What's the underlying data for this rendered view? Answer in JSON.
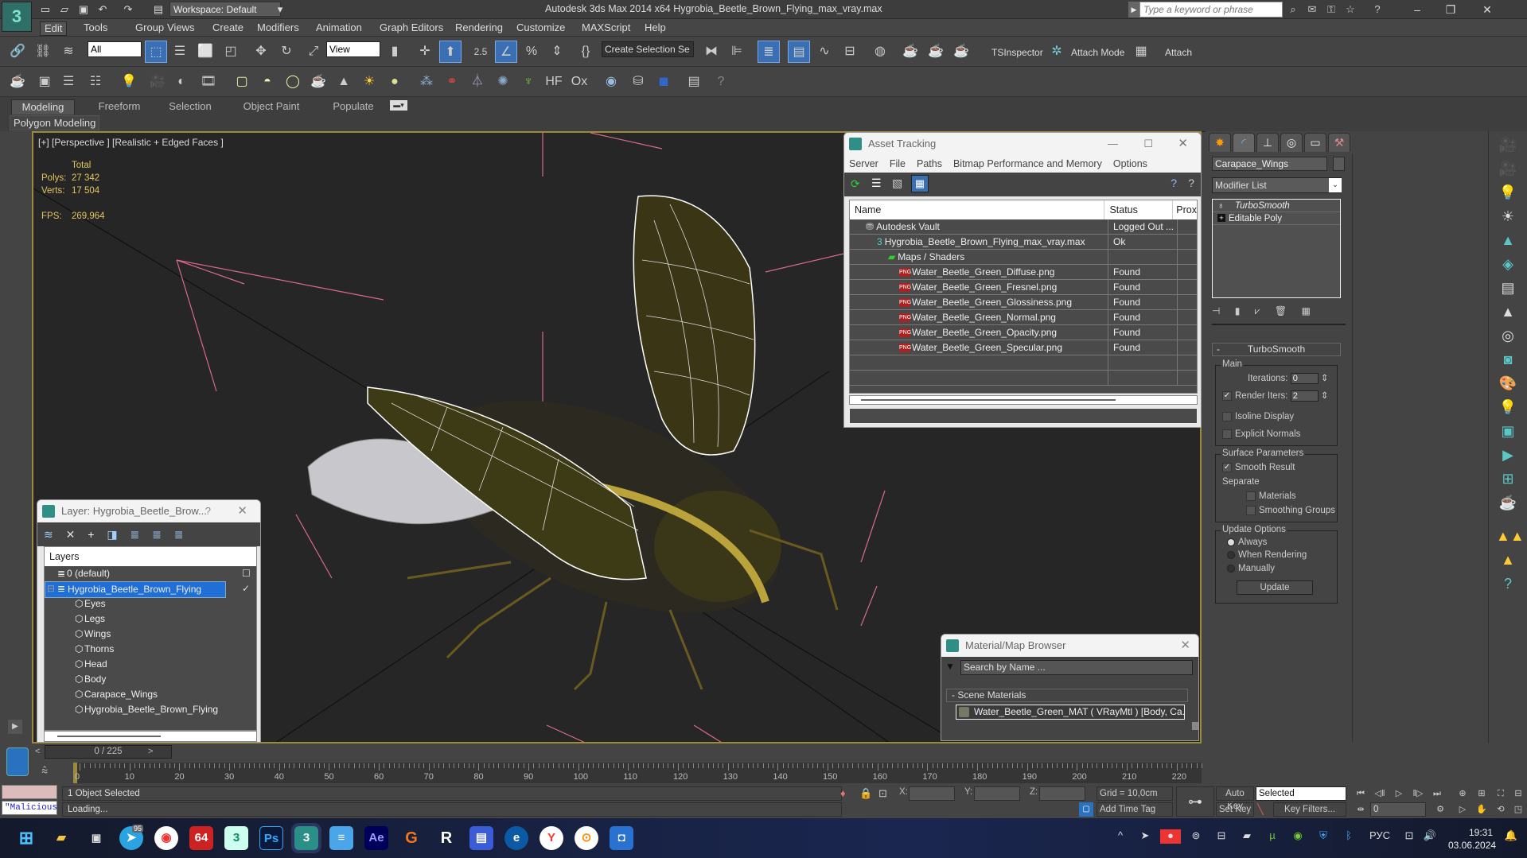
{
  "title_bar": {
    "app_logo": "3",
    "workspace": "Workspace: Default",
    "title": "Autodesk 3ds Max  2014 x64      Hygrobia_Beetle_Brown_Flying_max_vray.max",
    "search_placeholder": "Type a keyword or phrase",
    "window_controls": [
      "minimize",
      "maximize",
      "close"
    ]
  },
  "menu": [
    "Edit",
    "Tools",
    "Group",
    "Views",
    "Create",
    "Modifiers",
    "Animation",
    "Graph Editors",
    "Rendering",
    "Customize",
    "MAXScript",
    "Help"
  ],
  "toolbar": {
    "selection_filter": "All",
    "reference_coord": "View",
    "snap_angle": "2.5",
    "named_selection_placeholder": "Create Selection Se",
    "plugins": [
      "TSInspector",
      "Attach Mode",
      "Attach"
    ]
  },
  "ribbon": {
    "tabs": [
      "Modeling",
      "Freeform",
      "Selection",
      "Object Paint",
      "Populate"
    ],
    "active_tab": "Modeling",
    "panel": "Polygon Modeling"
  },
  "viewport": {
    "label": "[+] [Perspective ] [Realistic + Edged Faces ]",
    "stats": {
      "header": "Total",
      "polys_label": "Polys:",
      "polys": "27 342",
      "verts_label": "Verts:",
      "verts": "17 504",
      "fps_label": "FPS:",
      "fps": "269,964"
    }
  },
  "asset_tracking": {
    "title": "Asset Tracking",
    "menu": [
      "Server",
      "File",
      "Paths",
      "Bitmap Performance and Memory",
      "Options"
    ],
    "columns": [
      "Name",
      "Status",
      "Prox"
    ],
    "rows": [
      {
        "name": "Autodesk Vault",
        "status": "Logged Out ...",
        "level": 1,
        "icon": "vault-icon"
      },
      {
        "name": "Hygrobia_Beetle_Brown_Flying_max_vray.max",
        "status": "Ok",
        "level": 2,
        "icon": "max-file-icon"
      },
      {
        "name": "Maps / Shaders",
        "status": "",
        "level": 3,
        "icon": "maps-icon"
      },
      {
        "name": "Water_Beetle_Green_Diffuse.png",
        "status": "Found",
        "level": 4,
        "icon": "png-icon"
      },
      {
        "name": "Water_Beetle_Green_Fresnel.png",
        "status": "Found",
        "level": 4,
        "icon": "png-icon"
      },
      {
        "name": "Water_Beetle_Green_Glossiness.png",
        "status": "Found",
        "level": 4,
        "icon": "png-icon"
      },
      {
        "name": "Water_Beetle_Green_Normal.png",
        "status": "Found",
        "level": 4,
        "icon": "png-icon"
      },
      {
        "name": "Water_Beetle_Green_Opacity.png",
        "status": "Found",
        "level": 4,
        "icon": "png-icon"
      },
      {
        "name": "Water_Beetle_Green_Specular.png",
        "status": "Found",
        "level": 4,
        "icon": "png-icon"
      }
    ]
  },
  "layer_window": {
    "title": "Layer: Hygrobia_Beetle_Brow...",
    "help": "?",
    "header": "Layers",
    "layers": [
      {
        "name": "0 (default)",
        "level": 0,
        "selected": false
      },
      {
        "name": "Hygrobia_Beetle_Brown_Flying",
        "level": 0,
        "selected": true
      },
      {
        "name": "Eyes",
        "level": 1
      },
      {
        "name": "Legs",
        "level": 1
      },
      {
        "name": "Wings",
        "level": 1
      },
      {
        "name": "Thorns",
        "level": 1
      },
      {
        "name": "Head",
        "level": 1
      },
      {
        "name": "Body",
        "level": 1
      },
      {
        "name": "Carapace_Wings",
        "level": 1
      },
      {
        "name": "Hygrobia_Beetle_Brown_Flying",
        "level": 1
      }
    ]
  },
  "material_browser": {
    "title": "Material/Map Browser",
    "search_placeholder": "Search by Name ...",
    "section": "- Scene Materials",
    "item": "Water_Beetle_Green_MAT ( VRayMtl ) [Body, Ca..."
  },
  "command_panel": {
    "object_name": "Carapace_Wings",
    "modifier_list": "Modifier List",
    "stack": [
      "TurboSmooth",
      "Editable Poly"
    ],
    "rollout": {
      "title": "TurboSmooth",
      "main_label": "Main",
      "iterations_label": "Iterations:",
      "iterations": "0",
      "render_iters_label": "Render Iters:",
      "render_iters": "2",
      "render_iters_checked": true,
      "isoline_display": "Isoline Display",
      "explicit_normals": "Explicit Normals",
      "surface_params": "Surface Parameters",
      "smooth_result": "Smooth Result",
      "separate": "Separate",
      "materials": "Materials",
      "smoothing_groups": "Smoothing Groups",
      "update_options": "Update Options",
      "always": "Always",
      "when_rendering": "When Rendering",
      "manually": "Manually",
      "update_button": "Update"
    }
  },
  "timeline": {
    "slider": "0 / 225",
    "ticks": [
      0,
      10,
      20,
      30,
      40,
      50,
      60,
      70,
      80,
      90,
      100,
      110,
      120,
      130,
      140,
      150,
      160,
      170,
      180,
      190,
      200,
      210,
      220
    ],
    "max_frame": 225
  },
  "status_bar": {
    "maxscript": "\"Malicious s",
    "selection": "1 Object Selected",
    "prompt": "Loading...",
    "x_label": "X:",
    "y_label": "Y:",
    "z_label": "Z:",
    "grid": "Grid = 10,0cm",
    "add_time_tag": "Add Time Tag",
    "auto_key": "Auto Key",
    "set_key": "Set Key",
    "key_mode": "Selected",
    "key_filters": "Key Filters...",
    "current_frame": "0"
  },
  "taskbar": {
    "apps": [
      "start",
      "explorer",
      "task-view",
      "telegram",
      "chrome",
      "app-64",
      "3dsmax-2014",
      "photoshop",
      "3dsmax",
      "notepad",
      "after-effects",
      "g-app",
      "r-app",
      "floppy-app",
      "edge",
      "yandex",
      "vpn-app",
      "camera-app"
    ],
    "telegram_badge": "95",
    "language": "РУС",
    "time": "19:31",
    "date": "03.06.2024"
  }
}
